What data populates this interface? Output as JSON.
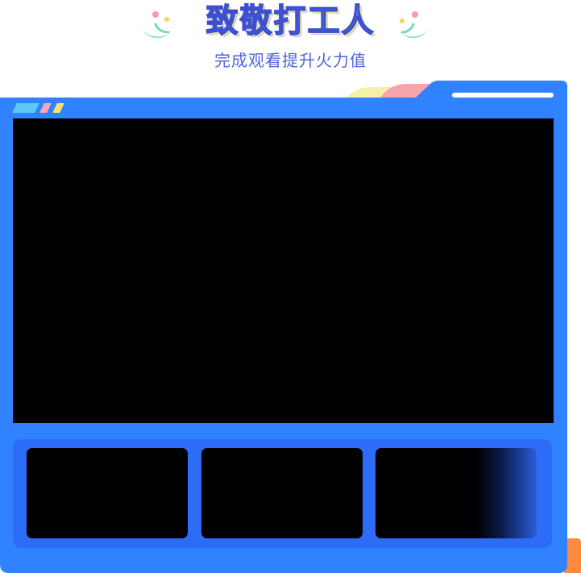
{
  "header": {
    "title": "致敬打工人",
    "subtitle": "完成观看提升火力值"
  },
  "colors": {
    "frame_blue": "#3182ff",
    "tray_blue": "#2d6cf7",
    "title_blue": "#5a73e8",
    "subtitle_blue": "#4f63e0",
    "tab_pink": "#f9a4ad",
    "tab_yellow": "#f7f0a8",
    "corner_orange": "#ff8a3d"
  },
  "icons": {
    "header_left": "confetti-icon",
    "header_right": "confetti-icon",
    "window_controls": [
      "dot-blue",
      "dot-pink",
      "dot-yellow"
    ]
  },
  "video": {
    "thumbnails": [
      {
        "name": "thumbnail-1"
      },
      {
        "name": "thumbnail-2"
      },
      {
        "name": "thumbnail-3"
      }
    ]
  }
}
